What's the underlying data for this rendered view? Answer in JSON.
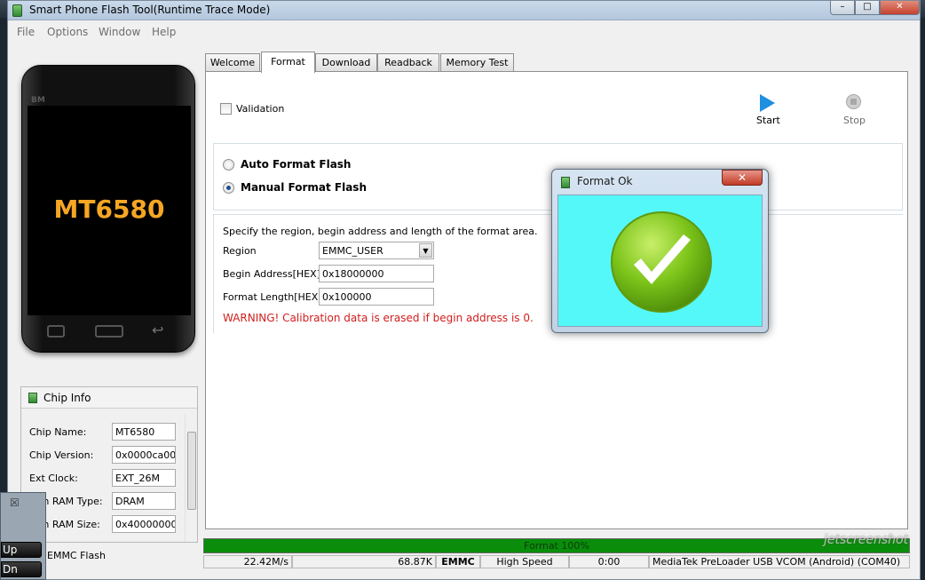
{
  "window": {
    "title": "Smart Phone Flash Tool(Runtime Trace Mode)",
    "controls": {
      "minimize": "–",
      "maximize": "□",
      "close": "✕"
    }
  },
  "menubar": {
    "items": [
      "File",
      "Options",
      "Window",
      "Help"
    ]
  },
  "phone": {
    "brand": "BM",
    "model": "MT6580"
  },
  "chip_info": {
    "title": "Chip Info",
    "rows": [
      {
        "label": "Chip Name:",
        "value": "MT6580"
      },
      {
        "label": "Chip Version:",
        "value": "0x0000ca00"
      },
      {
        "label": "Ext Clock:",
        "value": "EXT_26M"
      },
      {
        "label": "tern RAM Type:",
        "value": "DRAM"
      },
      {
        "label": "tern RAM Size:",
        "value": "0x40000000"
      }
    ],
    "storage_label": "EMMC Flash"
  },
  "tabs": [
    "Welcome",
    "Format",
    "Download",
    "Readback",
    "Memory Test"
  ],
  "active_tab": "Format",
  "format": {
    "validation_label": "Validation",
    "start_label": "Start",
    "stop_label": "Stop",
    "auto_format_label": "Auto Format Flash",
    "manual_format_label": "Manual Format Flash",
    "selected_mode": "manual",
    "description": "Specify the region, begin address and length of the format area.",
    "region_label": "Region",
    "region_value": "EMMC_USER",
    "begin_address_label": "Begin Address[HEX]:",
    "begin_address_value": "0x18000000",
    "format_length_label": "Format Length[HEX]:",
    "format_length_value": "0x100000",
    "warning": "WARNING! Calibration data is erased if begin address is 0."
  },
  "progress": {
    "percent": 100,
    "label": "Format 100%"
  },
  "status_bar": {
    "speed": "22.42M/s",
    "size": "68.87K",
    "storage": "EMMC",
    "usb_speed": "High Speed",
    "time": "0:00",
    "port": "MediaTek PreLoader USB VCOM (Android) (COM40)"
  },
  "dialog": {
    "title": "Format Ok",
    "close": "✕"
  },
  "background_widget": {
    "close": "☒",
    "up_label": "Up",
    "down_label": "Dn"
  },
  "watermark": "jetscreenshot"
}
